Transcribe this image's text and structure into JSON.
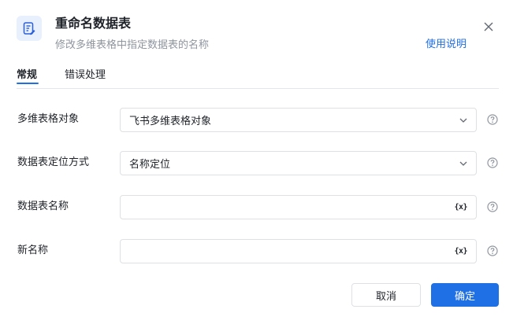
{
  "header": {
    "icon": "table-edit-icon",
    "title": "重命名数据表",
    "subtitle": "修改多维表格中指定数据表的名称",
    "help_link": "使用说明",
    "close_icon": "close-icon"
  },
  "tabs": [
    {
      "label": "常规",
      "active": true
    },
    {
      "label": "错误处理",
      "active": false
    }
  ],
  "form": {
    "rows": [
      {
        "label": "多维表格对象",
        "type": "select",
        "value": "飞书多维表格对象"
      },
      {
        "label": "数据表定位方式",
        "type": "select",
        "value": "名称定位"
      },
      {
        "label": "数据表名称",
        "type": "input",
        "value": "",
        "var_button": "{x}"
      },
      {
        "label": "新名称",
        "type": "input",
        "value": "",
        "var_button": "{x}"
      }
    ]
  },
  "footer": {
    "cancel_label": "取消",
    "confirm_label": "确定"
  },
  "colors": {
    "accent": "#1f6fe5",
    "border": "#dee0e3",
    "muted_text": "#8f959e"
  }
}
